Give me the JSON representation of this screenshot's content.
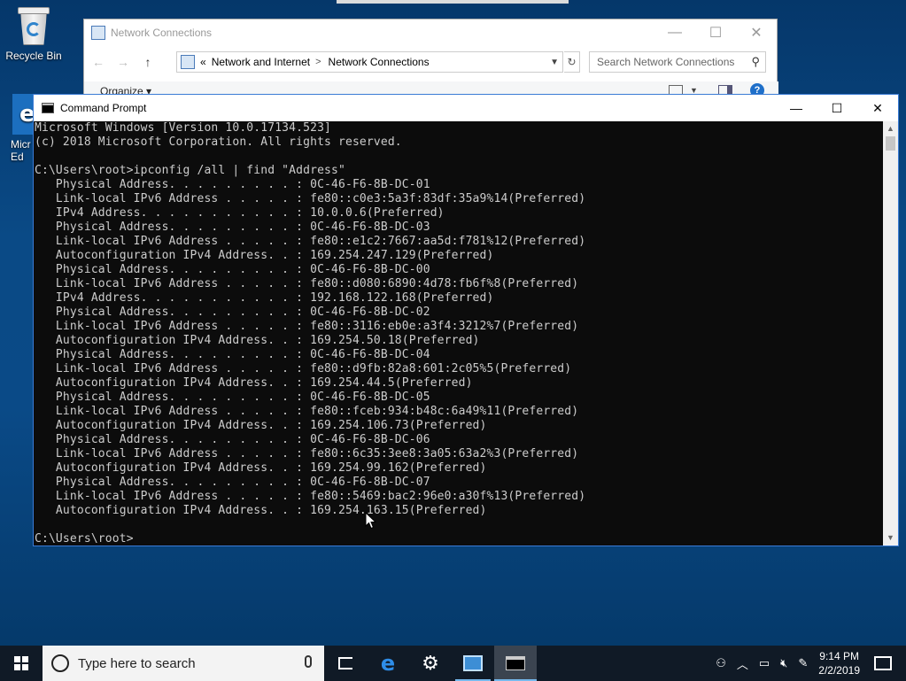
{
  "desktop": {
    "recycle_bin_label": "Recycle Bin",
    "edge_label_line1": "Micr",
    "edge_label_line2": "Ed"
  },
  "explorer": {
    "title": "Network Connections",
    "breadcrumb_prefix": "«",
    "breadcrumb": [
      "Network and Internet",
      "Network Connections"
    ],
    "breadcrumb_sep": ">",
    "search_placeholder": "Search Network Connections",
    "organize_label": "Organize",
    "organize_chevron": "▾"
  },
  "cmd": {
    "title": "Command Prompt",
    "lines": [
      "Microsoft Windows [Version 10.0.17134.523]",
      "(c) 2018 Microsoft Corporation. All rights reserved.",
      "",
      "C:\\Users\\root>ipconfig /all | find \"Address\"",
      "   Physical Address. . . . . . . . . : 0C-46-F6-8B-DC-01",
      "   Link-local IPv6 Address . . . . . : fe80::c0e3:5a3f:83df:35a9%14(Preferred)",
      "   IPv4 Address. . . . . . . . . . . : 10.0.0.6(Preferred)",
      "   Physical Address. . . . . . . . . : 0C-46-F6-8B-DC-03",
      "   Link-local IPv6 Address . . . . . : fe80::e1c2:7667:aa5d:f781%12(Preferred)",
      "   Autoconfiguration IPv4 Address. . : 169.254.247.129(Preferred)",
      "   Physical Address. . . . . . . . . : 0C-46-F6-8B-DC-00",
      "   Link-local IPv6 Address . . . . . : fe80::d080:6890:4d78:fb6f%8(Preferred)",
      "   IPv4 Address. . . . . . . . . . . : 192.168.122.168(Preferred)",
      "   Physical Address. . . . . . . . . : 0C-46-F6-8B-DC-02",
      "   Link-local IPv6 Address . . . . . : fe80::3116:eb0e:a3f4:3212%7(Preferred)",
      "   Autoconfiguration IPv4 Address. . : 169.254.50.18(Preferred)",
      "   Physical Address. . . . . . . . . : 0C-46-F6-8B-DC-04",
      "   Link-local IPv6 Address . . . . . : fe80::d9fb:82a8:601:2c05%5(Preferred)",
      "   Autoconfiguration IPv4 Address. . : 169.254.44.5(Preferred)",
      "   Physical Address. . . . . . . . . : 0C-46-F6-8B-DC-05",
      "   Link-local IPv6 Address . . . . . : fe80::fceb:934:b48c:6a49%11(Preferred)",
      "   Autoconfiguration IPv4 Address. . : 169.254.106.73(Preferred)",
      "   Physical Address. . . . . . . . . : 0C-46-F6-8B-DC-06",
      "   Link-local IPv6 Address . . . . . : fe80::6c35:3ee8:3a05:63a2%3(Preferred)",
      "   Autoconfiguration IPv4 Address. . : 169.254.99.162(Preferred)",
      "   Physical Address. . . . . . . . . : 0C-46-F6-8B-DC-07",
      "   Link-local IPv6 Address . . . . . : fe80::5469:bac2:96e0:a30f%13(Preferred)",
      "   Autoconfiguration IPv4 Address. . : 169.254.163.15(Preferred)",
      "",
      "C:\\Users\\root>"
    ]
  },
  "taskbar": {
    "search_placeholder": "Type here to search",
    "clock_time": "9:14 PM",
    "clock_date": "2/2/2019",
    "icons": [
      "start-icon",
      "task-view-icon",
      "edge-icon",
      "settings-icon",
      "network-connections-icon",
      "command-prompt-icon"
    ],
    "tray_icons": [
      "people-icon",
      "chevron-up-icon",
      "network-icon",
      "volume-muted-icon",
      "pen-icon",
      "action-center-icon"
    ]
  },
  "colors": {
    "console_bg": "#0c0c0c",
    "console_fg": "#cccccc",
    "cmd_border": "#3a7bd5",
    "taskbar_bg": "#101a26",
    "accent": "#76b9ed"
  }
}
